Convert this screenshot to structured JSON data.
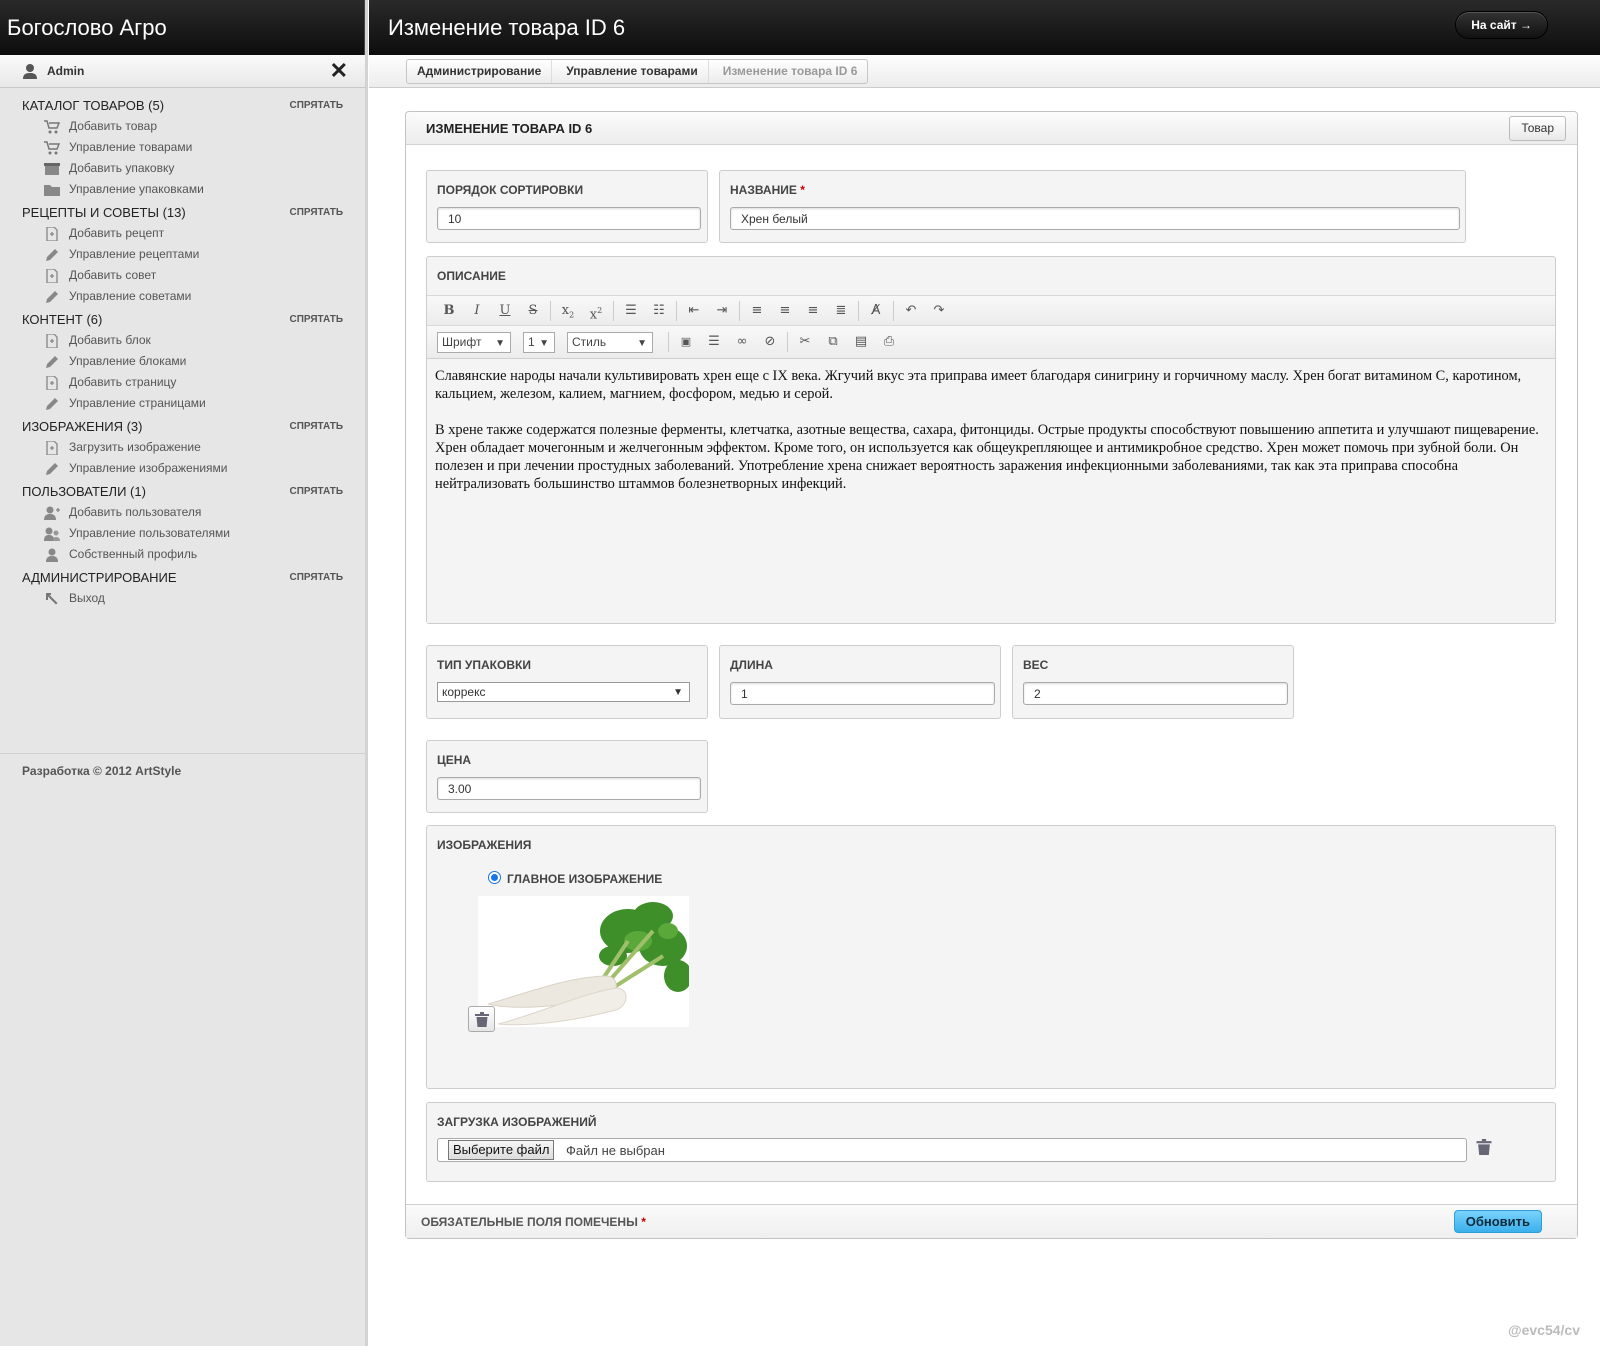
{
  "brand": "Богослово Агро",
  "user": {
    "name": "Admin"
  },
  "header": {
    "title": "Изменение товара ID 6",
    "site_button": "На сайт →"
  },
  "breadcrumbs": [
    "Администрирование",
    "Управление товарами",
    "Изменение товара ID 6"
  ],
  "sidebar": {
    "hide_label": "СПРЯТАТЬ",
    "sections": [
      {
        "title": "КАТАЛОГ ТОВАРОВ (5)",
        "items": [
          "Добавить товар",
          "Управление товарами",
          "Добавить упаковку",
          "Управление упаковками"
        ]
      },
      {
        "title": "РЕЦЕПТЫ И СОВЕТЫ (13)",
        "items": [
          "Добавить рецепт",
          "Управление рецептами",
          "Добавить совет",
          "Управление советами"
        ]
      },
      {
        "title": "КОНТЕНТ (6)",
        "items": [
          "Добавить блок",
          "Управление блоками",
          "Добавить страницу",
          "Управление страницами"
        ]
      },
      {
        "title": "ИЗОБРАЖЕНИЯ (3)",
        "items": [
          "Загрузить изображение",
          "Управление изображениями"
        ]
      },
      {
        "title": "ПОЛЬЗОВАТЕЛИ (1)",
        "items": [
          "Добавить пользователя",
          "Управление пользователями",
          "Собственный профиль"
        ]
      },
      {
        "title": "АДМИНИСТРИРОВАНИЕ",
        "items": [
          "Выход"
        ]
      }
    ],
    "footer": "Разработка © 2012 ArtStyle"
  },
  "panel": {
    "title": "ИЗМЕНЕНИЕ ТОВАРА ID 6",
    "tab": "Товар",
    "fields": {
      "sort": {
        "label": "ПОРЯДОК СОРТИРОВКИ",
        "value": "10"
      },
      "name": {
        "label": "НАЗВАНИЕ",
        "value": "Хрен белый"
      },
      "description": {
        "label": "ОПИСАНИЕ"
      },
      "package": {
        "label": "ТИП УПАКОВКИ",
        "value": "коррекс"
      },
      "length": {
        "label": "ДЛИНА",
        "value": "1"
      },
      "weight": {
        "label": "ВЕС",
        "value": "2"
      },
      "price": {
        "label": "ЦЕНА",
        "value": "3.00"
      },
      "images": {
        "label": "ИЗОБРАЖЕНИЯ",
        "main_label": "ГЛАВНОЕ ИЗОБРАЖЕНИЕ"
      },
      "upload": {
        "label": "ЗАГРУЗКА ИЗОБРАЖЕНИЙ",
        "button": "Выберите файл",
        "status": "Файл не выбран"
      }
    },
    "editor": {
      "font_select": "Шрифт",
      "size_select": "1",
      "style_select": "Стиль",
      "paragraphs": [
        "Славянские народы начали культивировать хрен еще с IX века. Жгучий вкус эта приправа имеет благодаря синигрину и горчичному маслу. Хрен богат витамином С, каротином, кальцием, железом, калием, магнием, фосфором, медью и серой.",
        "В хрене также содержатся полезные ферменты, клетчатка, азотные вещества, сахара, фитонциды. Острые продукты способствуют повышению аппетита и улучшают пищеварение. Хрен обладает мочегонным и желчегонным эффектом. Кроме того, он используется как общеукрепляющее и антимикробное средство. Хрен может помочь при зубной боли. Он полезен и при лечении простудных заболеваний. Употребление хрена снижает вероятность заражения инфекционными заболеваниями, так как эта приправа способна нейтрализовать большинство штаммов болезнетворных инфекций."
      ]
    },
    "footer": {
      "required_note": "ОБЯЗАТЕЛЬНЫЕ ПОЛЯ ПОМЕЧЕНЫ",
      "required_star": "*",
      "update_button": "Обновить"
    }
  },
  "watermark": "@evc54/cv"
}
